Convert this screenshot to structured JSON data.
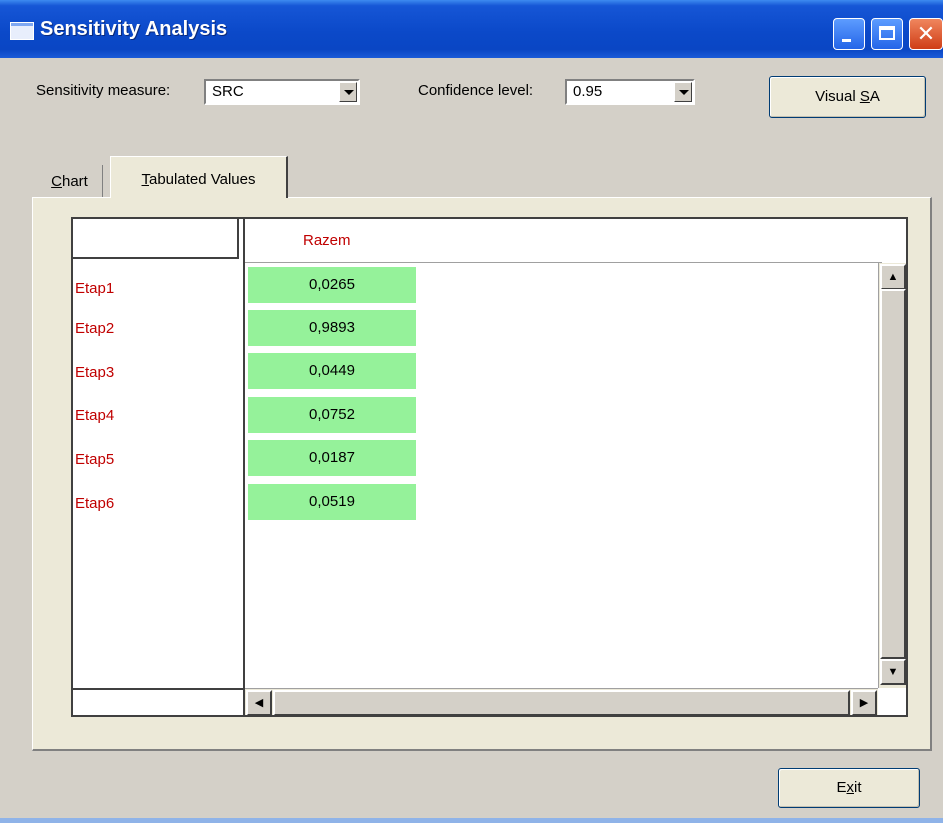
{
  "window": {
    "title": "Sensitivity Analysis"
  },
  "controls": {
    "measure_label": "Sensitivity measure:",
    "measure_value": "SRC",
    "confidence_label": "Confidence level:",
    "confidence_value": "0.95",
    "visual_sa_prefix": "Visual ",
    "visual_sa_mnemonic": "S",
    "visual_sa_suffix": "A",
    "exit_prefix": "E",
    "exit_mnemonic": "x",
    "exit_suffix": "it"
  },
  "tabs": {
    "chart_mnemonic": "C",
    "chart_rest": "hart",
    "tabulated_mnemonic": "T",
    "tabulated_rest": "abulated Values",
    "active": "Tabulated Values"
  },
  "table": {
    "column_header": "Razem",
    "rows": [
      {
        "label": "Etap1",
        "value": "0,0265"
      },
      {
        "label": "Etap2",
        "value": "0,9893"
      },
      {
        "label": "Etap3",
        "value": "0,0449"
      },
      {
        "label": "Etap4",
        "value": "0,0752"
      },
      {
        "label": "Etap5",
        "value": "0,0187"
      },
      {
        "label": "Etap6",
        "value": "0,0519"
      }
    ],
    "label_color": "#c00000",
    "cell_color": "#95f29a"
  },
  "icons": [
    "app-window-icon",
    "minimize-icon",
    "maximize-icon",
    "close-icon",
    "dropdown-arrow-icon",
    "scroll-up-icon",
    "scroll-down-icon",
    "scroll-left-icon",
    "scroll-right-icon"
  ]
}
